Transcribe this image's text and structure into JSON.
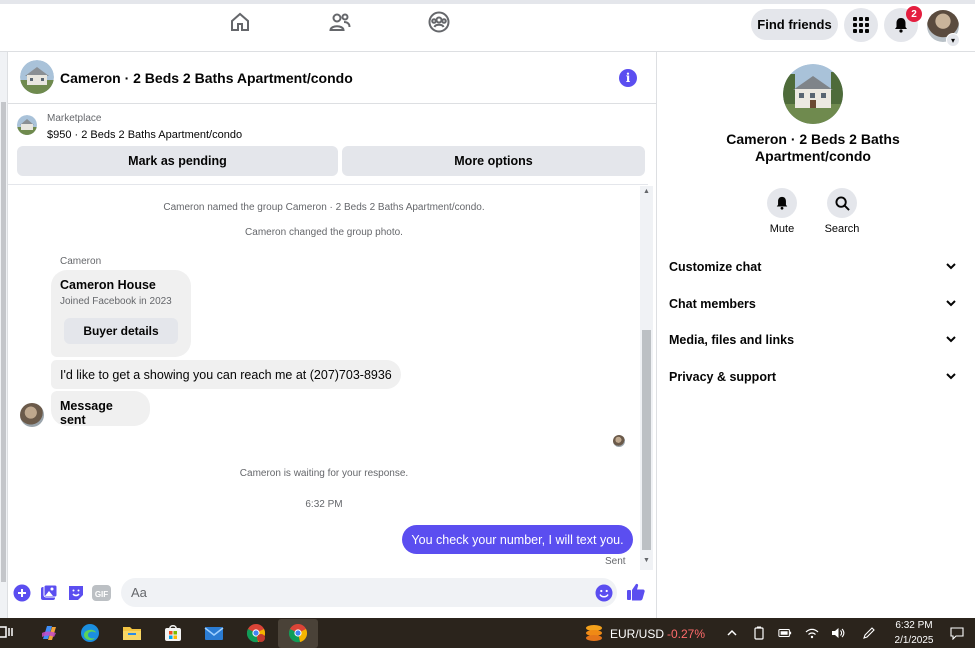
{
  "topbar": {
    "find_friends_label": "Find friends",
    "notification_count": "2",
    "icons": [
      "home-icon",
      "friends-icon",
      "groups-icon",
      "menu-grid-icon",
      "bell-icon"
    ]
  },
  "chat": {
    "title": "Cameron · 2 Beds 2 Baths Apartment/condo",
    "marketplace_label": "Marketplace",
    "listing_price": "$950 · 2 Beds 2 Baths Apartment/condo",
    "mark_pending_label": "Mark as pending",
    "more_options_label": "More options",
    "system_messages": [
      "Cameron named the group Cameron · 2 Beds 2 Baths Apartment/condo.",
      "Cameron changed the group photo."
    ],
    "sender_name": "Cameron",
    "card": {
      "name": "Cameron House",
      "subtitle": "Joined Facebook in 2023",
      "button_label": "Buyer details"
    },
    "messages": [
      "I'd like to get a showing you can reach me at (207)703-8936",
      "Message sent"
    ],
    "waiting_notice": "Cameron is waiting for your response.",
    "timestamp": "6:32 PM",
    "my_message": "You check your number, I will text you.",
    "sent_status": "Sent",
    "composer_placeholder": "Aa"
  },
  "right_panel": {
    "title": "Cameron · 2 Beds 2 Baths Apartment/condo",
    "mute_label": "Mute",
    "search_label": "Search",
    "sections": [
      "Customize chat",
      "Chat members",
      "Media, files and links",
      "Privacy & support"
    ]
  },
  "taskbar": {
    "ticker_name": "EUR/USD",
    "ticker_change": "-0.27%",
    "clock_time": "6:32 PM",
    "clock_date": "2/1/2025"
  },
  "colors": {
    "accent": "#5b4ef0",
    "badge": "#e41e3f",
    "bubble_gray": "#f0f0f0",
    "taskbar": "#2b241c",
    "negative": "#ff6b6b"
  }
}
